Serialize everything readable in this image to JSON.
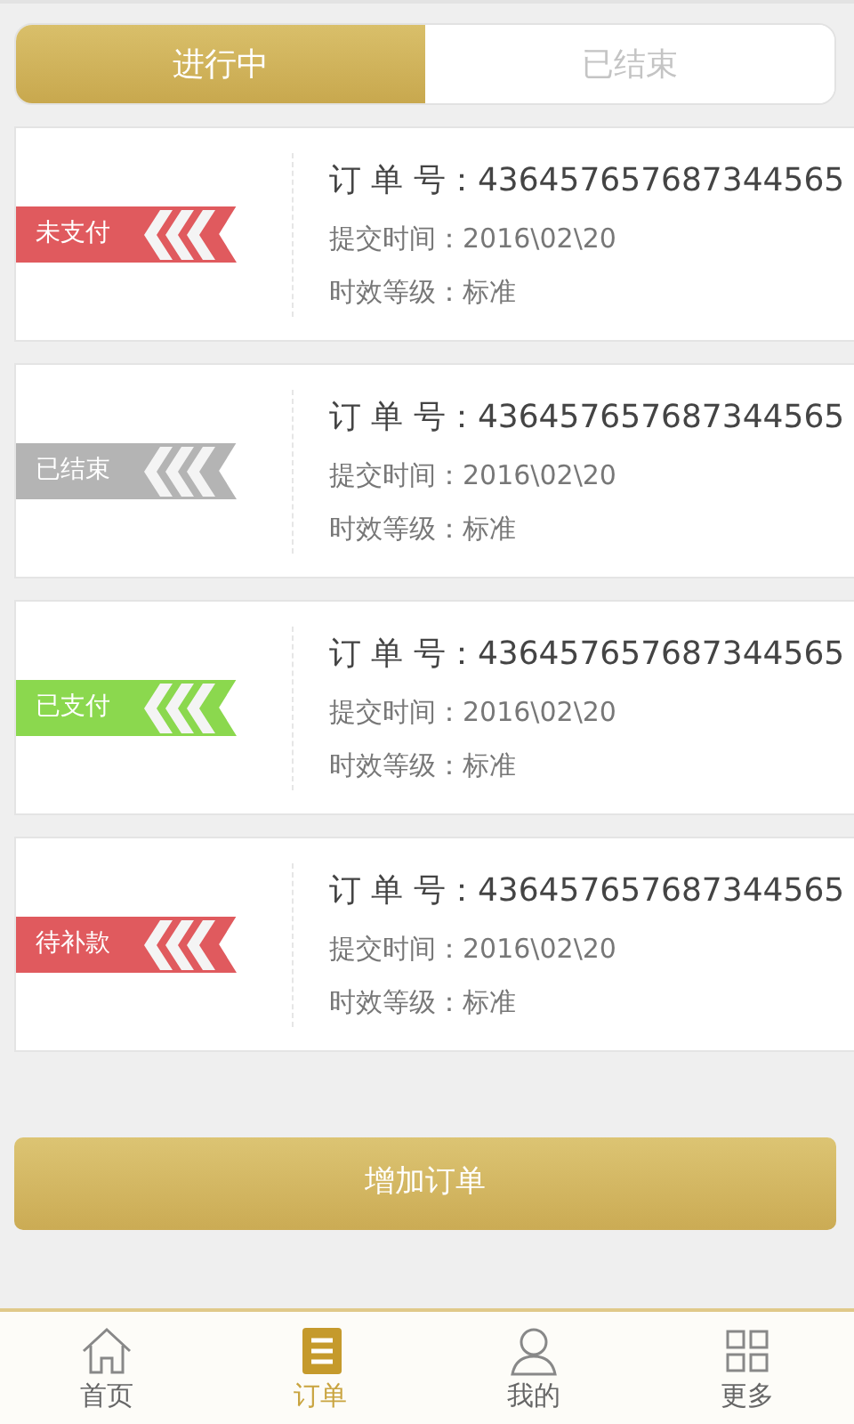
{
  "tabs": [
    {
      "label": "进行中",
      "selected": true
    },
    {
      "label": "已结束",
      "selected": false
    }
  ],
  "orders": [
    {
      "status": "未支付",
      "color": "#e05a5e",
      "order_label": "订 单 号：",
      "order_no": "436457657687344565",
      "time_label": "提交时间：",
      "time": "2016\\02\\20",
      "level_label": "时效等级：",
      "level_value": "标准"
    },
    {
      "status": "已结束",
      "color": "#b4b4b4",
      "order_label": "订 单 号：",
      "order_no": "436457657687344565",
      "time_label": "提交时间：",
      "time": "2016\\02\\20",
      "level_label": "时效等级：",
      "level_value": "标准"
    },
    {
      "status": "已支付",
      "color": "#8bd84e",
      "order_label": "订 单 号：",
      "order_no": "436457657687344565",
      "time_label": "提交时间：",
      "time": "2016\\02\\20",
      "level_label": "时效等级：",
      "level_value": "标准"
    },
    {
      "status": "待补款",
      "color": "#e05a5e",
      "order_label": "订 单 号：",
      "order_no": "436457657687344565",
      "time_label": "提交时间：",
      "time": "2016\\02\\20",
      "level_label": "时效等级：",
      "level_value": "标准"
    }
  ],
  "add_button": "增加订单",
  "nav": [
    {
      "label": "首页",
      "kind": "home",
      "selected": false
    },
    {
      "label": "订单",
      "kind": "orders",
      "selected": true
    },
    {
      "label": "我的",
      "kind": "profile",
      "selected": false
    },
    {
      "label": "更多",
      "kind": "more",
      "selected": false
    }
  ]
}
